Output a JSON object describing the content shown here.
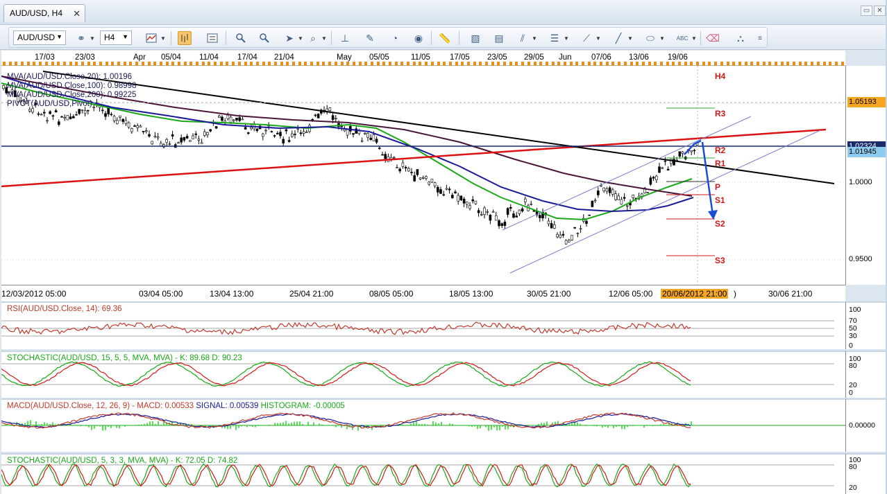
{
  "window": {
    "tab_title": "AUD/USD, H4",
    "close_glyph": "✕",
    "restore_glyph": "▭",
    "close_window_glyph": "✕"
  },
  "toolbar": {
    "symbol_value": "AUD/USD",
    "timeframe_value": "H4",
    "icons": [
      "link-icon",
      "chart-type-icon",
      "bar-chart-icon",
      "indicator-icon",
      "zoom-in-icon",
      "zoom-out-icon",
      "cursor-icon",
      "crosshair-zoom-icon",
      "snap-icon",
      "pencil-edit-icon",
      "period-icon",
      "globe-icon",
      "ruler-icon",
      "image-icon",
      "template-icon",
      "line-tools-icon",
      "horizontal-lines-icon",
      "fibonacci-icon",
      "trendline-icon",
      "ellipse-icon",
      "text-icon",
      "eraser-icon",
      "hierarchy-icon",
      "overflow-icon"
    ]
  },
  "date_strip": [
    "17/03",
    "23/03",
    "Apr",
    "05/04",
    "11/04",
    "17/04",
    "21/04",
    "May",
    "05/05",
    "11/05",
    "17/05",
    "23/05",
    "29/05",
    "Jun",
    "07/06",
    "13/06",
    "19/06"
  ],
  "main": {
    "legend": [
      {
        "text": "MVA(AUD/USD.Close,20): 1.00196",
        "color": "#18a818"
      },
      {
        "text": "MVA(AUD/USD.Close,100): 0.98998",
        "color": "#1a1a99"
      },
      {
        "text": "MVA(AUD/USD.Close,200): 0.99225",
        "color": "#4a1538"
      },
      {
        "text": "PIVOT(AUD/USD,Pivot)",
        "color": "#000000"
      }
    ],
    "pivot_labels": [
      "H4",
      "R3",
      "R2",
      "R1",
      "P",
      "S1",
      "S2",
      "S3"
    ],
    "price_ticks": [
      "1.05193",
      "1.02324",
      "1.01945",
      "1.0000",
      "0.9500"
    ],
    "time_ticks": [
      "12/03/2012 05:00",
      "03/04 05:00",
      "13/04 13:00",
      "25/04 21:00",
      "08/05 05:00",
      "18/05 13:00",
      "30/05 21:00",
      "12/06 05:00",
      "20/06/2012 21:00",
      "30/06 21:00"
    ],
    "current_time_suffix": ")"
  },
  "panels": [
    {
      "title": "RSI(AUD/USD.Close, 14): 69.36",
      "title_color": "#c0392b",
      "axis": [
        "100",
        "70",
        "50",
        "30",
        "0"
      ]
    },
    {
      "title": "STOCHASTIC(AUD/USD, 15, 5, 5, MVA, MVA)  -  K: 89.68   D: 90.23",
      "title_color": "#18a818",
      "axis": [
        "100",
        "80",
        "20",
        "0"
      ]
    },
    {
      "title_parts": [
        "MACD(AUD/USD.Close, 12, 26, 9)  -  MACD: 0.00533   ",
        "SIGNAL: 0.00539   ",
        "HISTOGRAM: -0.00005"
      ],
      "title_colors": [
        "#c0392b",
        "#1a1a99",
        "#18a818"
      ],
      "axis": [
        "0.00000"
      ]
    },
    {
      "title": "STOCHASTIC(AUD/USD, 5, 3, 3, MVA, MVA)  -  K: 72.05   D: 74.82",
      "title_color": "#18a818",
      "axis": [
        "100",
        "80",
        "20"
      ]
    }
  ],
  "colors": {
    "candle": "#000000",
    "ma20": "#18a818",
    "ma100": "#1a1a99",
    "ma200": "#4a1538",
    "trend_red": "#dd1111",
    "trend_black": "#000000",
    "channel": "#7a7fc8",
    "arrow": "#1a4cd1",
    "resistance_green": "#2ca62c",
    "support_red": "#d31818",
    "highlight": "#f5a623"
  }
}
